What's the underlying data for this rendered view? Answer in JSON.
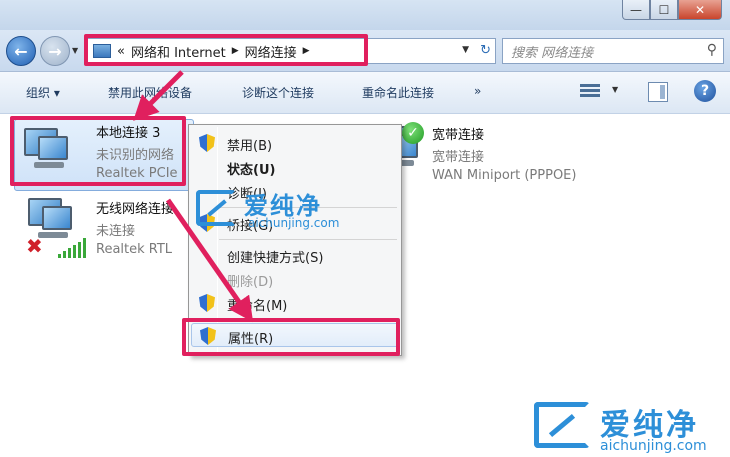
{
  "window": {
    "min_glyph": "—",
    "max_glyph": "☐",
    "close_glyph": "✕"
  },
  "address": {
    "prefix": "«",
    "crumbs": [
      "网络和 Internet",
      "网络连接"
    ],
    "sep": "▶"
  },
  "search": {
    "placeholder": "搜索 网络连接"
  },
  "toolbar": {
    "organize": "组织 ▾",
    "disable": "禁用此网络设备",
    "diagnose": "诊断这个连接",
    "rename": "重命名此连接",
    "more": "»",
    "help": "?"
  },
  "connections": [
    {
      "name": "本地连接 3",
      "status": "未识别的网络",
      "device": "Realtek PCIe"
    },
    {
      "name": "无线网络连接",
      "status": "未连接",
      "device": "Realtek RTL"
    },
    {
      "name": "宽带连接",
      "status": "宽带连接",
      "device": "WAN Miniport (PPPOE)"
    }
  ],
  "context_menu": {
    "items": [
      {
        "label": "禁用(B)"
      },
      {
        "label": "状态(U)"
      },
      {
        "label": "诊断(I)"
      },
      {
        "label": "桥接(G)"
      },
      {
        "label": "创建快捷方式(S)"
      },
      {
        "label": "删除(D)"
      },
      {
        "label": "重命名(M)"
      },
      {
        "label": "属性(R)"
      }
    ]
  },
  "watermark": {
    "brand": "爱纯净",
    "url": "aichunjing.com"
  },
  "colors": {
    "highlight": "#e0205e",
    "accent": "#2d8fd8"
  }
}
